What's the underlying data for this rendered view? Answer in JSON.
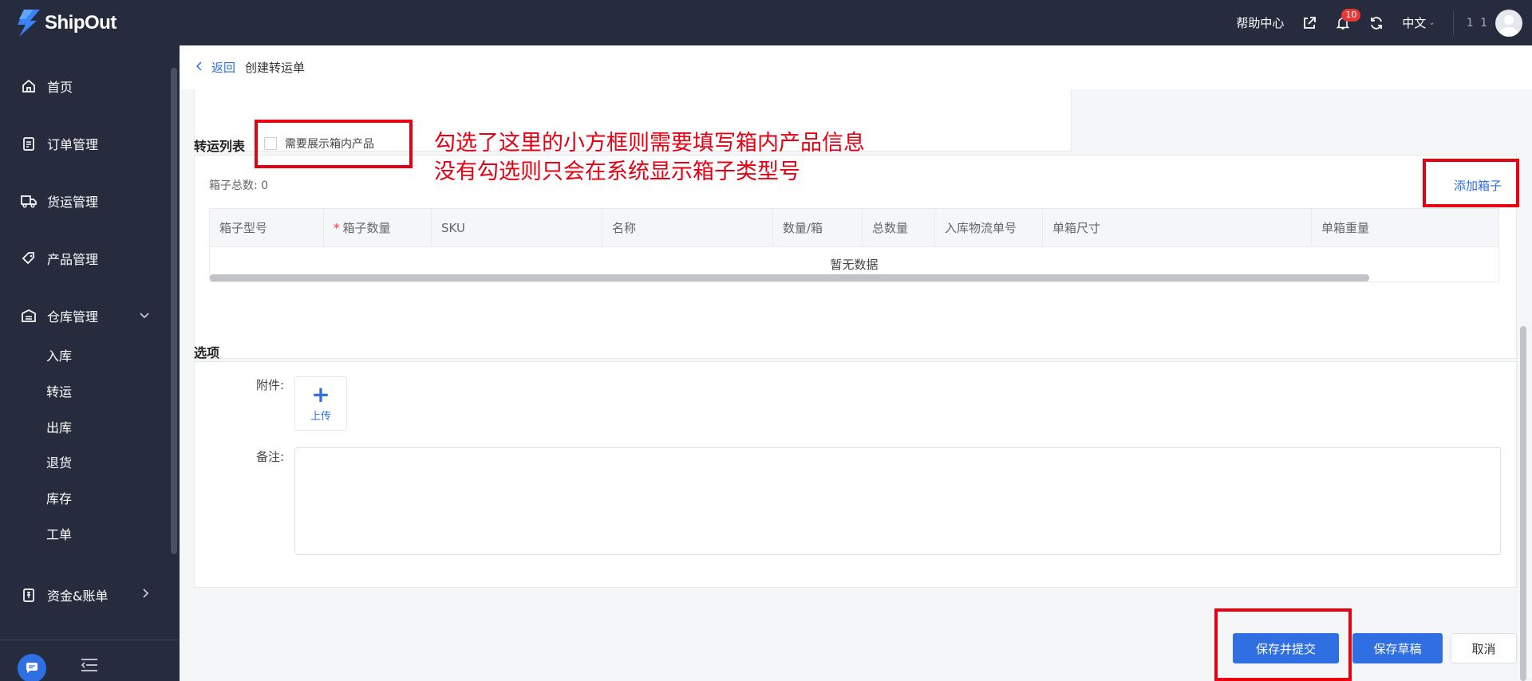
{
  "app": {
    "brand": "ShipOut"
  },
  "header": {
    "help_center": "帮助中心",
    "notification_count": "10",
    "language": "中文",
    "user_name": "1 1"
  },
  "sidebar": {
    "items": [
      {
        "label": "首页",
        "icon": "home-icon"
      },
      {
        "label": "订单管理",
        "icon": "order-icon"
      },
      {
        "label": "货运管理",
        "icon": "truck-icon"
      },
      {
        "label": "产品管理",
        "icon": "tag-icon"
      },
      {
        "label": "仓库管理",
        "icon": "warehouse-icon",
        "expanded": true
      },
      {
        "label": "资金&账单",
        "icon": "bill-icon"
      }
    ],
    "sub_items": [
      "入库",
      "转运",
      "出库",
      "退货",
      "库存",
      "工单"
    ]
  },
  "breadcrumb": {
    "back": "返回",
    "current": "创建转运单"
  },
  "transfer_list": {
    "title": "转运列表",
    "show_products_label": "需要展示箱内产品",
    "box_total": "箱子总数: 0",
    "add_box": "添加箱子",
    "columns": [
      "箱子型号",
      "箱子数量",
      "SKU",
      "名称",
      "数量/箱",
      "总数量",
      "入库物流单号",
      "单箱尺寸",
      "单箱重量"
    ],
    "empty_text": "暂无数据"
  },
  "options": {
    "title": "选项",
    "attachment_label": "附件:",
    "upload_label": "上传",
    "remark_label": "备注:"
  },
  "actions": {
    "save_submit": "保存并提交",
    "save_draft": "保存草稿",
    "cancel": "取消"
  },
  "annotation": {
    "line1": "勾选了这里的小方框则需要填写箱内产品信息",
    "line2": "没有勾选则只会在系统显示箱子类型号",
    "color": "#e60012"
  },
  "colors": {
    "primary": "#2f6ee3",
    "sidebar_bg": "#262c3e"
  }
}
